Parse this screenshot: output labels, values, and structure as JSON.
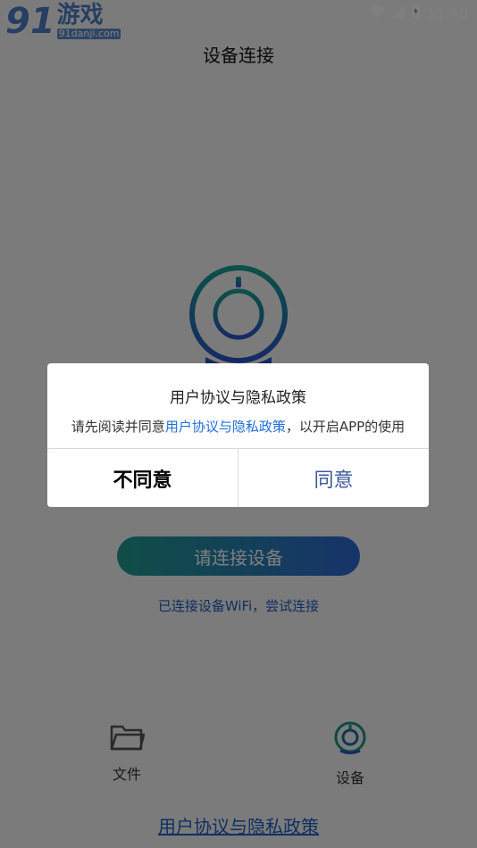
{
  "status_bar": {
    "time": "11:40"
  },
  "logo": {
    "number": "91",
    "name": "游戏",
    "url": "91danji.com"
  },
  "header": {
    "title": "设备连接"
  },
  "main": {
    "connect_button": "请连接设备",
    "wifi_link": "已连接设备WiFi，尝试连接"
  },
  "nav": {
    "items": [
      {
        "label": "文件",
        "icon": "folder-icon"
      },
      {
        "label": "设备",
        "icon": "camera-icon"
      }
    ]
  },
  "footer": {
    "policy_link": "用户协议与隐私政策"
  },
  "dialog": {
    "title": "用户协议与隐私政策",
    "message_prefix": "请先阅读并同意",
    "message_link": "用户协议与隐私政策",
    "message_suffix": "，以开启APP的使用",
    "disagree_label": "不同意",
    "agree_label": "同意"
  },
  "colors": {
    "accent_blue": "#1f5fc4",
    "gradient_start": "#1f9c8c",
    "gradient_end": "#2f68d6"
  }
}
